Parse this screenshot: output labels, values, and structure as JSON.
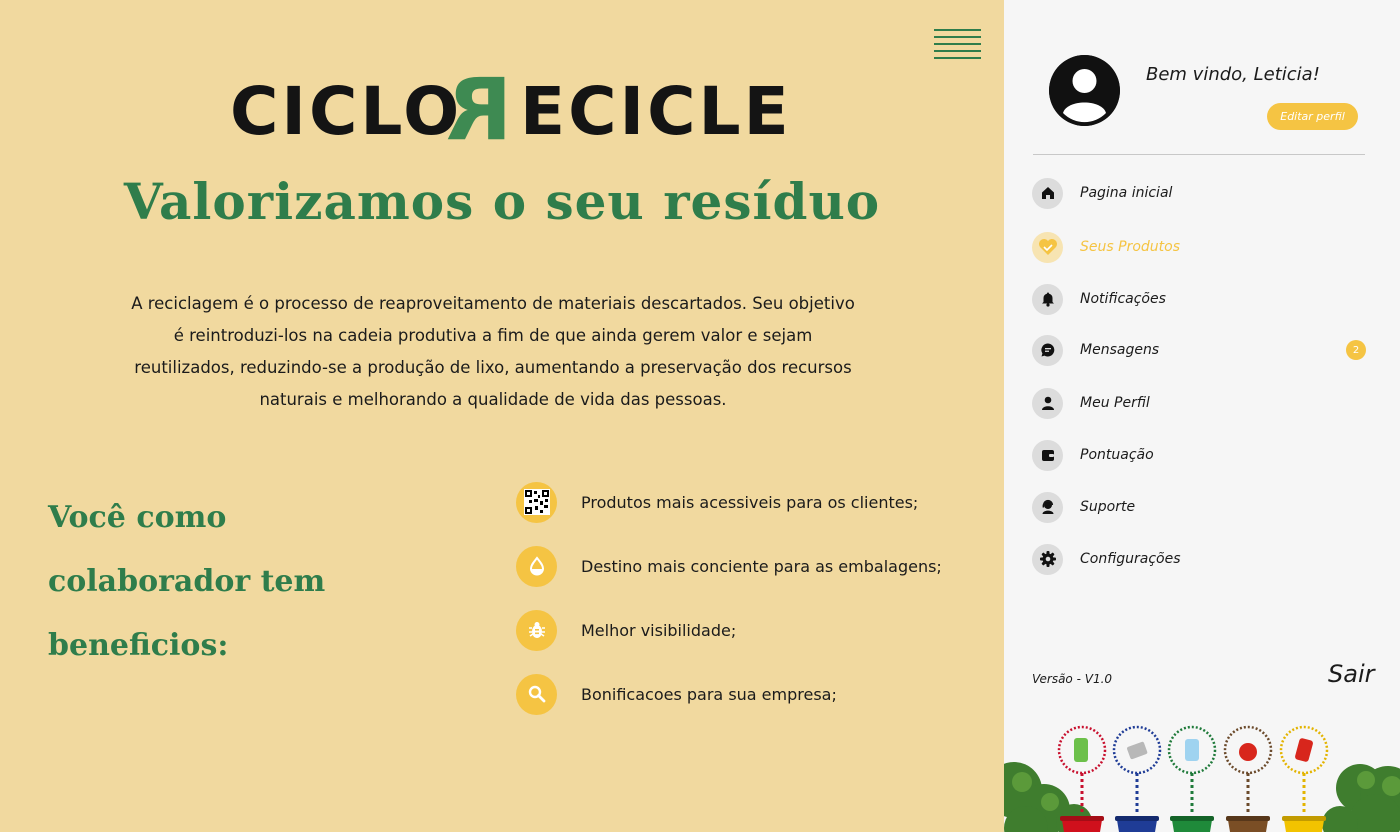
{
  "brand": {
    "logo_left": "CICLO",
    "logo_r": "R",
    "logo_right": "ECICLE"
  },
  "main": {
    "headline": "Valorizamos o seu resíduo",
    "intro": "A reciclagem é o processo de reaproveitamento de materiais descartados. Seu objetivo é reintroduzi-los na cadeia produtiva a fim de que ainda gerem valor e sejam reutilizados, reduzindo-se a produção de lixo, aumentando a preservação dos recursos naturais e melhorando a qualidade de vida das pessoas.",
    "benefits_title": "Você como colaborador tem beneficios:",
    "benefits": [
      {
        "icon": "qr-code-icon",
        "text": "Produtos mais acessiveis para os clientes;"
      },
      {
        "icon": "water-drop-icon",
        "text": "Destino mais conciente para as embalagens;"
      },
      {
        "icon": "bug-icon",
        "text": "Melhor visibilidade;"
      },
      {
        "icon": "search-icon",
        "text": "Bonificacoes para sua empresa;"
      }
    ]
  },
  "sidebar": {
    "welcome": "Bem vindo, Leticia!",
    "edit_profile": "Editar perfil",
    "items": [
      {
        "icon": "home-icon",
        "label": "Pagina inicial"
      },
      {
        "icon": "handshake-heart-icon",
        "label": "Seus Produtos",
        "active": true
      },
      {
        "icon": "bell-icon",
        "label": "Notificações"
      },
      {
        "icon": "chat-icon",
        "label": "Mensagens",
        "badge": "2"
      },
      {
        "icon": "user-icon",
        "label": "Meu Perfil"
      },
      {
        "icon": "wallet-icon",
        "label": "Pontuação"
      },
      {
        "icon": "support-agent-icon",
        "label": "Suporte"
      },
      {
        "icon": "gear-icon",
        "label": "Configurações"
      }
    ],
    "version": "Versão - V1.0",
    "logout": "Sair"
  },
  "colors": {
    "background": "#f1d99f",
    "brand_green": "#2f7d4b",
    "accent_yellow": "#f5c443",
    "sidebar_bg": "#f6f6f6"
  }
}
